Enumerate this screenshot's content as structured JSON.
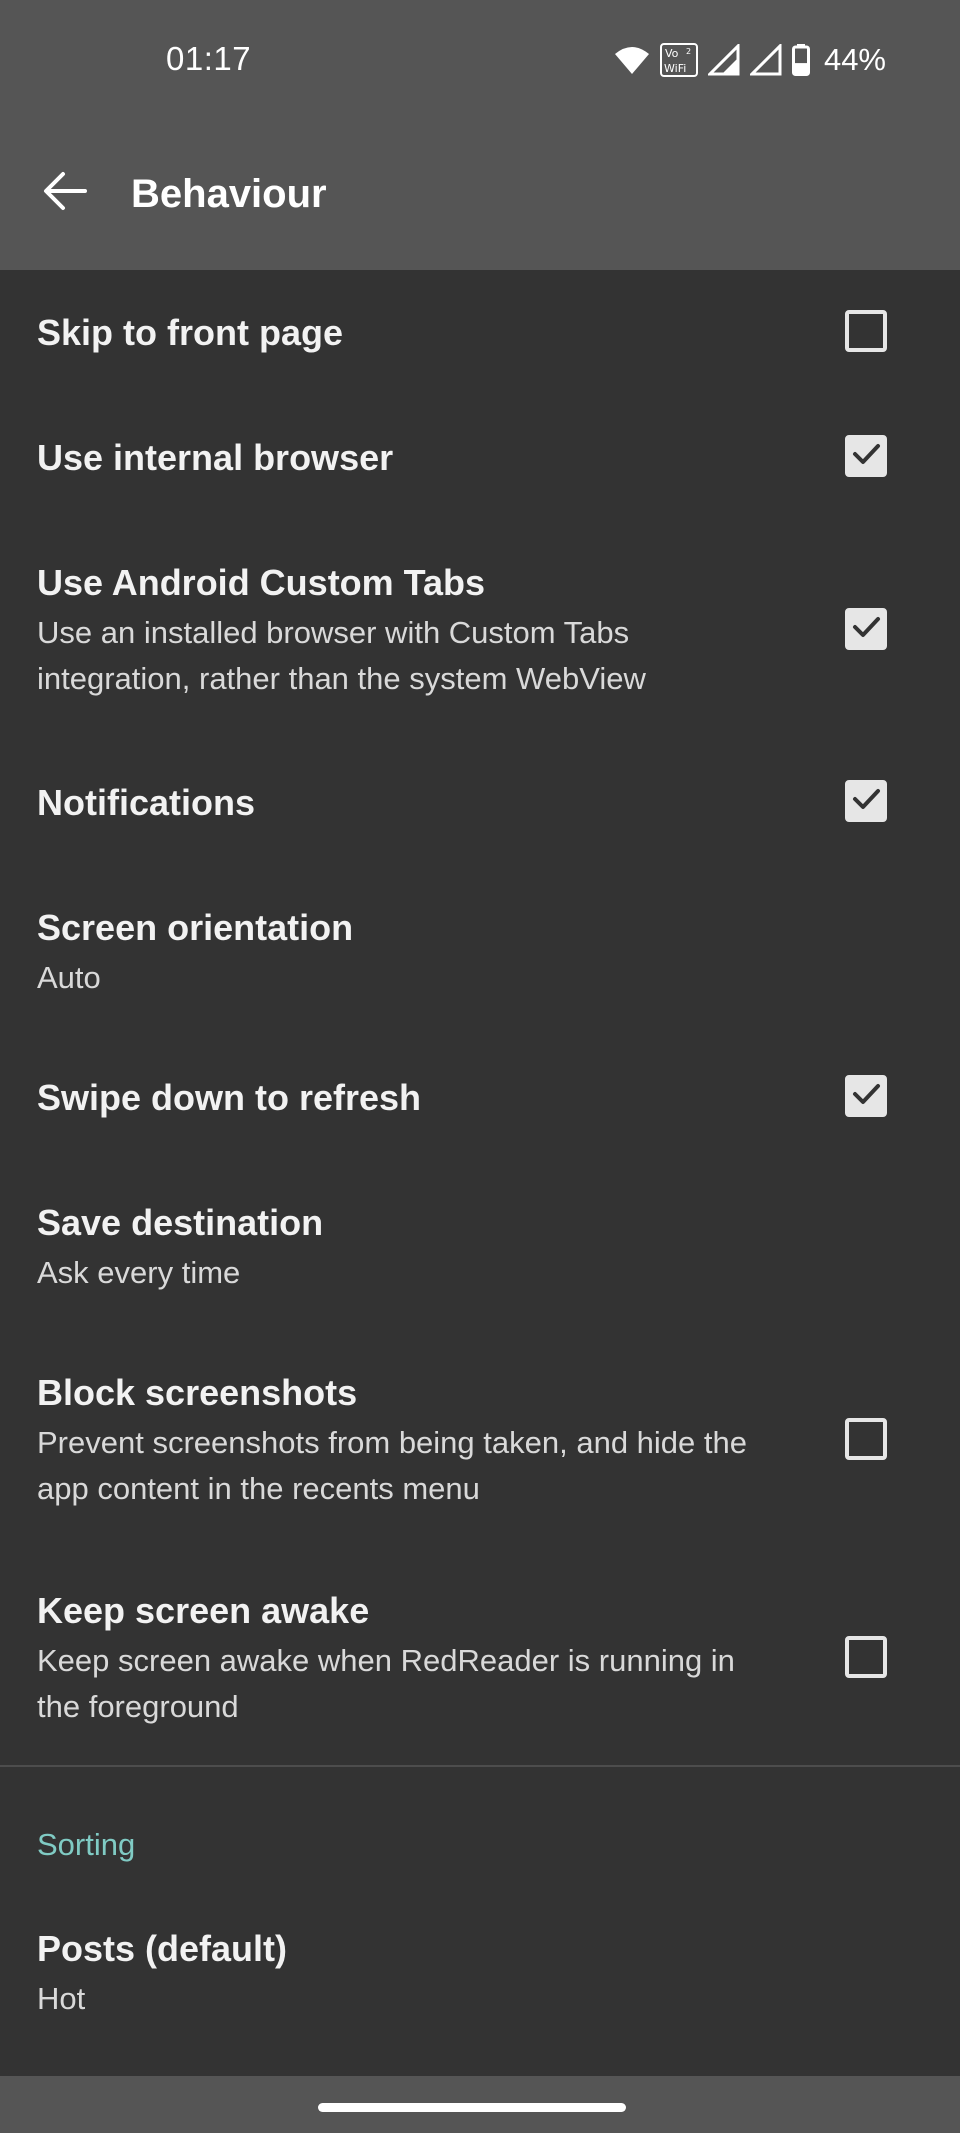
{
  "status_bar": {
    "time": "01:17",
    "vowifi_top": "Vo",
    "vowifi_bottom": "WiFi",
    "sim_slot": "2",
    "battery_percent": "44%",
    "battery_level": 0.44,
    "icons": [
      "wifi-icon",
      "vowifi-icon",
      "signal-icon",
      "signal-icon",
      "battery-icon"
    ]
  },
  "app_bar": {
    "title": "Behaviour",
    "back_icon": "arrow-back-icon"
  },
  "preferences": [
    {
      "id": "skip-front-page",
      "title": "Skip to front page",
      "summary": "",
      "checkbox": true,
      "checked": false
    },
    {
      "id": "internal-browser",
      "title": "Use internal browser",
      "summary": "",
      "checkbox": true,
      "checked": true
    },
    {
      "id": "custom-tabs",
      "title": "Use Android Custom Tabs",
      "summary": "Use an installed browser with Custom Tabs integration, rather than the system WebView",
      "checkbox": true,
      "checked": true
    },
    {
      "id": "notifications",
      "title": "Notifications",
      "summary": "",
      "checkbox": true,
      "checked": true
    },
    {
      "id": "screen-orientation",
      "title": "Screen orientation",
      "summary": "Auto",
      "checkbox": false
    },
    {
      "id": "swipe-refresh",
      "title": "Swipe down to refresh",
      "summary": "",
      "checkbox": true,
      "checked": true
    },
    {
      "id": "save-destination",
      "title": "Save destination",
      "summary": "Ask every time",
      "checkbox": false
    },
    {
      "id": "block-screenshots",
      "title": "Block screenshots",
      "summary": "Prevent screenshots from being taken, and hide the app content in the recents menu",
      "checkbox": true,
      "checked": false
    },
    {
      "id": "keep-awake",
      "title": "Keep screen awake",
      "summary": "Keep screen awake when RedReader is running in the foreground",
      "checkbox": true,
      "checked": false
    }
  ],
  "sorting": {
    "category_label": "Sorting",
    "posts_default": {
      "title": "Posts (default)",
      "summary": "Hot"
    }
  },
  "colors": {
    "toolbar": "#555555",
    "background": "#333333",
    "accent": "#80cbc4",
    "checkbox": "#e6e6e6"
  }
}
